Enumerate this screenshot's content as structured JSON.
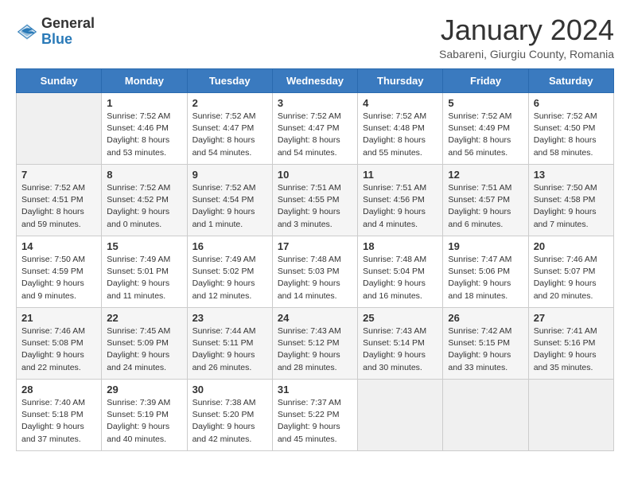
{
  "header": {
    "logo_general": "General",
    "logo_blue": "Blue",
    "month_title": "January 2024",
    "subtitle": "Sabareni, Giurgiu County, Romania"
  },
  "days_of_week": [
    "Sunday",
    "Monday",
    "Tuesday",
    "Wednesday",
    "Thursday",
    "Friday",
    "Saturday"
  ],
  "weeks": [
    [
      {
        "num": "",
        "empty": true
      },
      {
        "num": "1",
        "sunrise": "7:52 AM",
        "sunset": "4:46 PM",
        "daylight": "8 hours and 53 minutes."
      },
      {
        "num": "2",
        "sunrise": "7:52 AM",
        "sunset": "4:47 PM",
        "daylight": "8 hours and 54 minutes."
      },
      {
        "num": "3",
        "sunrise": "7:52 AM",
        "sunset": "4:47 PM",
        "daylight": "8 hours and 54 minutes."
      },
      {
        "num": "4",
        "sunrise": "7:52 AM",
        "sunset": "4:48 PM",
        "daylight": "8 hours and 55 minutes."
      },
      {
        "num": "5",
        "sunrise": "7:52 AM",
        "sunset": "4:49 PM",
        "daylight": "8 hours and 56 minutes."
      },
      {
        "num": "6",
        "sunrise": "7:52 AM",
        "sunset": "4:50 PM",
        "daylight": "8 hours and 58 minutes."
      }
    ],
    [
      {
        "num": "7",
        "sunrise": "7:52 AM",
        "sunset": "4:51 PM",
        "daylight": "8 hours and 59 minutes."
      },
      {
        "num": "8",
        "sunrise": "7:52 AM",
        "sunset": "4:52 PM",
        "daylight": "9 hours and 0 minutes."
      },
      {
        "num": "9",
        "sunrise": "7:52 AM",
        "sunset": "4:54 PM",
        "daylight": "9 hours and 1 minute."
      },
      {
        "num": "10",
        "sunrise": "7:51 AM",
        "sunset": "4:55 PM",
        "daylight": "9 hours and 3 minutes."
      },
      {
        "num": "11",
        "sunrise": "7:51 AM",
        "sunset": "4:56 PM",
        "daylight": "9 hours and 4 minutes."
      },
      {
        "num": "12",
        "sunrise": "7:51 AM",
        "sunset": "4:57 PM",
        "daylight": "9 hours and 6 minutes."
      },
      {
        "num": "13",
        "sunrise": "7:50 AM",
        "sunset": "4:58 PM",
        "daylight": "9 hours and 7 minutes."
      }
    ],
    [
      {
        "num": "14",
        "sunrise": "7:50 AM",
        "sunset": "4:59 PM",
        "daylight": "9 hours and 9 minutes."
      },
      {
        "num": "15",
        "sunrise": "7:49 AM",
        "sunset": "5:01 PM",
        "daylight": "9 hours and 11 minutes."
      },
      {
        "num": "16",
        "sunrise": "7:49 AM",
        "sunset": "5:02 PM",
        "daylight": "9 hours and 12 minutes."
      },
      {
        "num": "17",
        "sunrise": "7:48 AM",
        "sunset": "5:03 PM",
        "daylight": "9 hours and 14 minutes."
      },
      {
        "num": "18",
        "sunrise": "7:48 AM",
        "sunset": "5:04 PM",
        "daylight": "9 hours and 16 minutes."
      },
      {
        "num": "19",
        "sunrise": "7:47 AM",
        "sunset": "5:06 PM",
        "daylight": "9 hours and 18 minutes."
      },
      {
        "num": "20",
        "sunrise": "7:46 AM",
        "sunset": "5:07 PM",
        "daylight": "9 hours and 20 minutes."
      }
    ],
    [
      {
        "num": "21",
        "sunrise": "7:46 AM",
        "sunset": "5:08 PM",
        "daylight": "9 hours and 22 minutes."
      },
      {
        "num": "22",
        "sunrise": "7:45 AM",
        "sunset": "5:09 PM",
        "daylight": "9 hours and 24 minutes."
      },
      {
        "num": "23",
        "sunrise": "7:44 AM",
        "sunset": "5:11 PM",
        "daylight": "9 hours and 26 minutes."
      },
      {
        "num": "24",
        "sunrise": "7:43 AM",
        "sunset": "5:12 PM",
        "daylight": "9 hours and 28 minutes."
      },
      {
        "num": "25",
        "sunrise": "7:43 AM",
        "sunset": "5:14 PM",
        "daylight": "9 hours and 30 minutes."
      },
      {
        "num": "26",
        "sunrise": "7:42 AM",
        "sunset": "5:15 PM",
        "daylight": "9 hours and 33 minutes."
      },
      {
        "num": "27",
        "sunrise": "7:41 AM",
        "sunset": "5:16 PM",
        "daylight": "9 hours and 35 minutes."
      }
    ],
    [
      {
        "num": "28",
        "sunrise": "7:40 AM",
        "sunset": "5:18 PM",
        "daylight": "9 hours and 37 minutes."
      },
      {
        "num": "29",
        "sunrise": "7:39 AM",
        "sunset": "5:19 PM",
        "daylight": "9 hours and 40 minutes."
      },
      {
        "num": "30",
        "sunrise": "7:38 AM",
        "sunset": "5:20 PM",
        "daylight": "9 hours and 42 minutes."
      },
      {
        "num": "31",
        "sunrise": "7:37 AM",
        "sunset": "5:22 PM",
        "daylight": "9 hours and 45 minutes."
      },
      {
        "num": "",
        "empty": true
      },
      {
        "num": "",
        "empty": true
      },
      {
        "num": "",
        "empty": true
      }
    ]
  ],
  "labels": {
    "sunrise": "Sunrise:",
    "sunset": "Sunset:",
    "daylight": "Daylight:"
  }
}
